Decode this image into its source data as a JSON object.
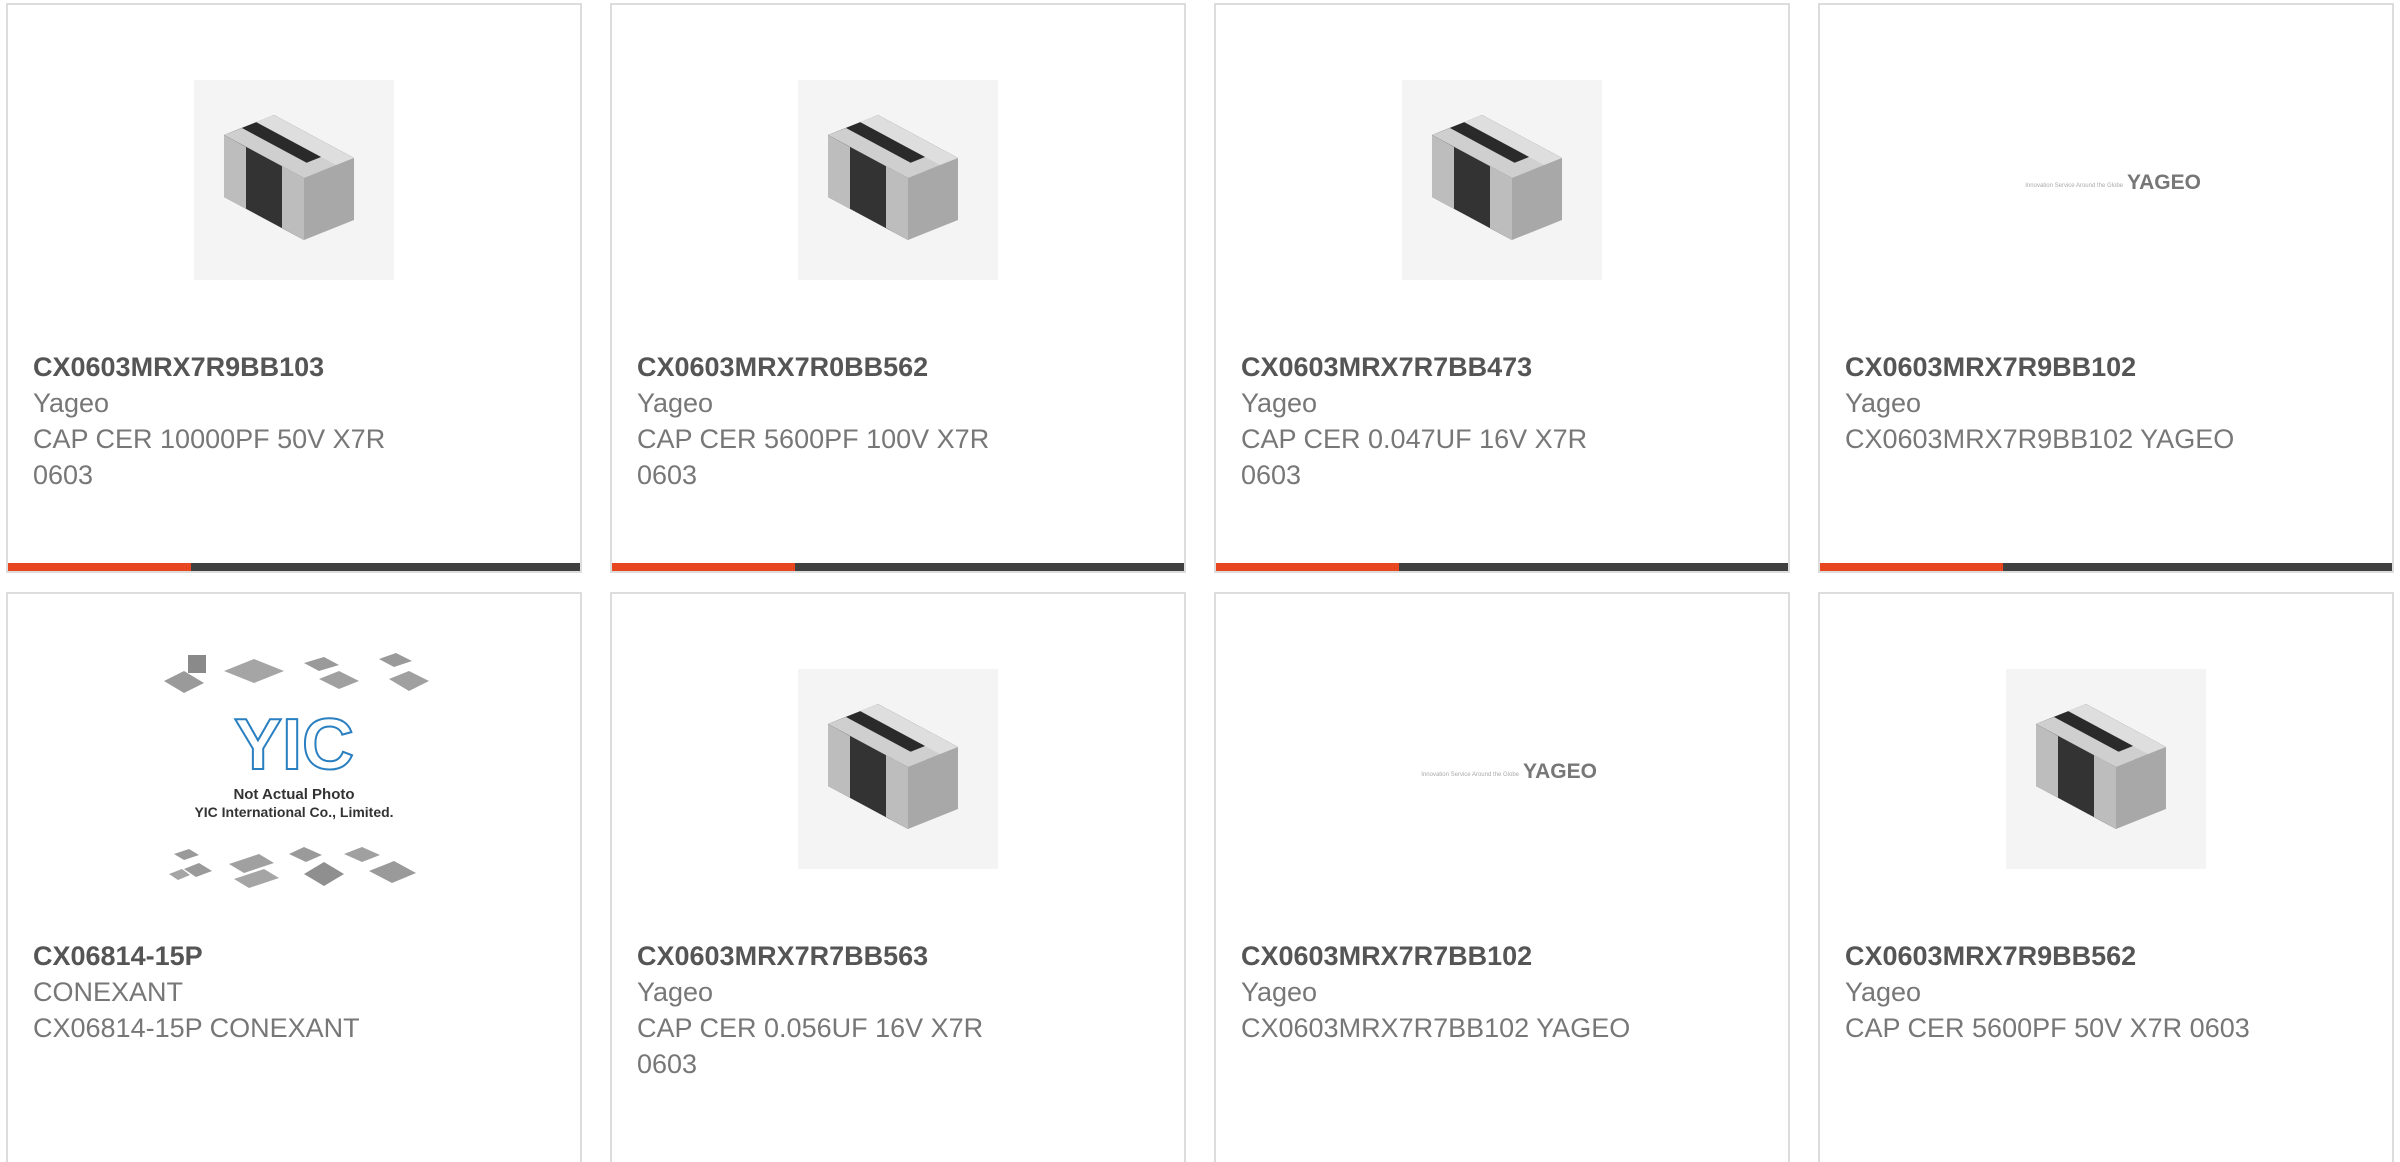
{
  "products": [
    {
      "part_number": "CX0603MRX7R9BB103",
      "manufacturer": "Yageo",
      "description": "CAP CER 10000PF 50V X7R 0603",
      "image": "capacitor-chip"
    },
    {
      "part_number": "CX0603MRX7R0BB562",
      "manufacturer": "Yageo",
      "description": "CAP CER 5600PF 100V X7R 0603",
      "image": "capacitor-chip"
    },
    {
      "part_number": "CX0603MRX7R7BB473",
      "manufacturer": "Yageo",
      "description": "CAP CER 0.047UF 16V X7R 0603",
      "image": "capacitor-chip"
    },
    {
      "part_number": "CX0603MRX7R9BB102",
      "manufacturer": "Yageo",
      "description": "CX0603MRX7R9BB102 YAGEO",
      "image": "yageo-logo"
    },
    {
      "part_number": "CX06814-15P",
      "manufacturer": "CONEXANT",
      "description": "CX06814-15P CONEXANT",
      "image": "not-actual-photo"
    },
    {
      "part_number": "CX0603MRX7R7BB563",
      "manufacturer": "Yageo",
      "description": "CAP CER 0.056UF 16V X7R 0603",
      "image": "capacitor-chip"
    },
    {
      "part_number": "CX0603MRX7R7BB102",
      "manufacturer": "Yageo",
      "description": "CX0603MRX7R7BB102 YAGEO",
      "image": "yageo-logo"
    },
    {
      "part_number": "CX0603MRX7R9BB562",
      "manufacturer": "Yageo",
      "description": "CAP CER 5600PF 50V X7R 0603",
      "image": "capacitor-chip"
    }
  ],
  "logo_text": {
    "yageo_brand": "YAGEO",
    "yageo_tagline": "Innovation Service Around the Globe",
    "placeholder_brand": "YIC",
    "placeholder_line1": "Not Actual Photo",
    "placeholder_line2": "YIC International Co., Limited."
  },
  "colors": {
    "accent": "#e8461e",
    "bar": "#404040",
    "border": "#dcdcdc",
    "part_number_text": "#555555",
    "secondary_text": "#777777"
  }
}
